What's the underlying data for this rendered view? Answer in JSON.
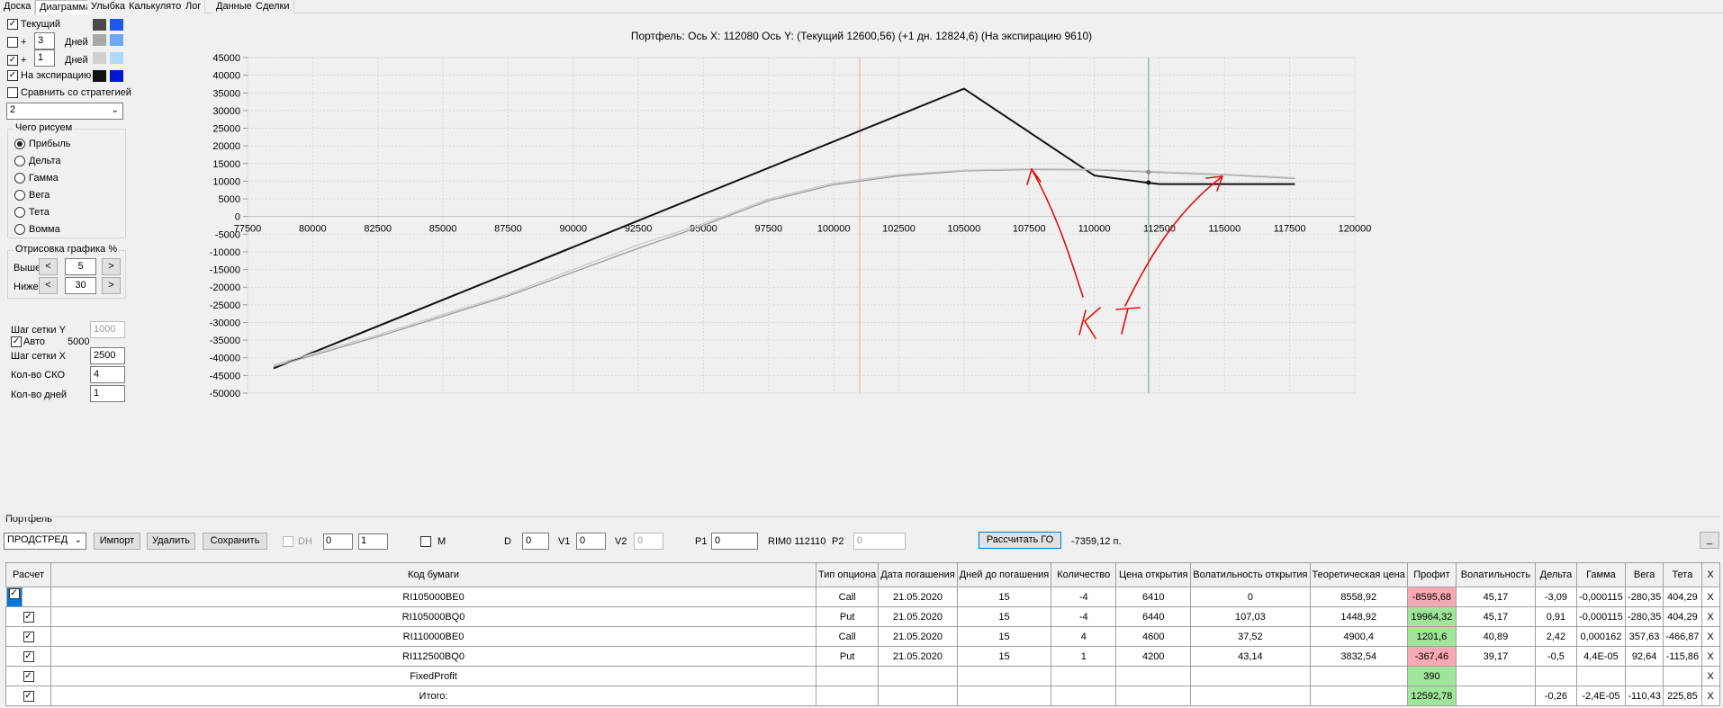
{
  "tabs": [
    "Доска",
    "Диаграмма",
    "Улыбка",
    "Калькулятор",
    "Лог",
    "Данные",
    "Сделки"
  ],
  "active_tab": "Диаграмма",
  "left_panel": {
    "current_label": "Текущий",
    "plus_label": "+",
    "days_label": "Дней",
    "days1_value": "3",
    "days2_value": "1",
    "expiry_label": "На экспирацию",
    "compare_label": "Сравнить со стратегией",
    "strategy_select": "2",
    "draw_group_title": "Чего рисуем",
    "draw_options": [
      "Прибыль",
      "Дельта",
      "Гамма",
      "Вега",
      "Тета",
      "Вомма"
    ],
    "render_group_title": "Отрисовка графика %",
    "above_label": "Выше",
    "above_value": "5",
    "below_label": "Ниже",
    "below_value": "30",
    "left_btn": "<",
    "right_btn": ">",
    "grid_y_label": "Шаг сетки Y",
    "grid_y_value": "1000",
    "auto_label": "Авто",
    "auto_value": "5000",
    "grid_x_label": "Шаг сетки X",
    "grid_x_value": "2500",
    "sko_label": "Кол-во СКО",
    "sko_value": "4",
    "days_count_label": "Кол-во дней",
    "days_count_value": "1",
    "swatches": {
      "current": [
        "#4a4a4a",
        "#1e56f0"
      ],
      "plus3": [
        "#a8a8a8",
        "#6ea8f5"
      ],
      "plus1": [
        "#cfcfcf",
        "#b0d8fa"
      ],
      "expiry": [
        "#111111",
        "#0015d0"
      ]
    }
  },
  "chart_title": "Портфель: Ось X: 112080 Ось Y:  (Текущий 12600,56)  (+1 дн. 12824,6)  (На экспирацию 9610)",
  "chart_data": {
    "type": "line",
    "xlim": [
      77500,
      120000
    ],
    "ylim": [
      -50000,
      45000
    ],
    "x_ticks": [
      "77500",
      "80000",
      "82500",
      "85000",
      "87500",
      "90000",
      "92500",
      "95000",
      "97500",
      "100000",
      "102500",
      "105000",
      "107500",
      "110000",
      "112500",
      "115000",
      "117500",
      "120000"
    ],
    "y_ticks": [
      "45000",
      "40000",
      "35000",
      "30000",
      "25000",
      "20000",
      "15000",
      "10000",
      "5000",
      "0",
      "-5000",
      "-10000",
      "-15000",
      "-20000",
      "-25000",
      "-30000",
      "-35000",
      "-40000",
      "-45000",
      "-50000"
    ],
    "red_marker_x": 101000,
    "cursor_x": 112080,
    "series": [
      {
        "color": "#111111",
        "points": [
          [
            78500,
            -43000
          ],
          [
            105000,
            36200
          ],
          [
            110000,
            11600
          ],
          [
            112000,
            9610
          ],
          [
            112500,
            9200
          ],
          [
            117700,
            9200
          ]
        ]
      },
      {
        "color": "#9a9a9a",
        "points": [
          [
            78500,
            -42500
          ],
          [
            82500,
            -34000
          ],
          [
            87500,
            -22500
          ],
          [
            92500,
            -9000
          ],
          [
            95000,
            -2500
          ],
          [
            97500,
            4500
          ],
          [
            100000,
            9000
          ],
          [
            102500,
            11500
          ],
          [
            105000,
            12900
          ],
          [
            107500,
            13300
          ],
          [
            110000,
            13200
          ],
          [
            112080,
            12600
          ],
          [
            115000,
            11800
          ],
          [
            117700,
            10800
          ]
        ]
      },
      {
        "color": "#c8c8c8",
        "points": [
          [
            78500,
            -42000
          ],
          [
            82500,
            -33500
          ],
          [
            87500,
            -22000
          ],
          [
            92500,
            -8000
          ],
          [
            95000,
            -2000
          ],
          [
            97500,
            5000
          ],
          [
            100000,
            9500
          ],
          [
            102500,
            11900
          ],
          [
            105000,
            13100
          ],
          [
            107500,
            13500
          ],
          [
            110000,
            13400
          ],
          [
            112080,
            12824
          ],
          [
            115000,
            12000
          ],
          [
            117700,
            11000
          ]
        ]
      }
    ],
    "grid": true,
    "annotation": "КТ"
  },
  "portfolio": {
    "group_label": "Портфель",
    "portfolio_select": "ПРОДСТРЕД",
    "import_btn": "Импорт",
    "delete_btn": "Удалить",
    "save_btn": "Сохранить",
    "dh_label": "DH",
    "dh_v1": "0",
    "dh_v2": "1",
    "m_label": "M",
    "d_label": "D",
    "d_value": "0",
    "v1_label": "V1",
    "v1_value": "0",
    "v2_label": "V2",
    "v2_value": "0",
    "p1_label": "P1",
    "p1_value": "0",
    "rim_label": "RIM0 112110",
    "p2_label": "P2",
    "p2_value": "0",
    "calc_btn": "Рассчитать ГО",
    "go_value": "-7359,12 п.",
    "min_btn": "_"
  },
  "table": {
    "headers": [
      "Расчет",
      "Код бумаги",
      "Тип опциона",
      "Дата погашения",
      "Дней до погашения",
      "Количество",
      "Цена открытия",
      "Волатильность открытия",
      "Теоретическая цена",
      "Профит",
      "Волатильность",
      "Дельта",
      "Гамма",
      "Вега",
      "Тета",
      "X"
    ],
    "rows": [
      {
        "code": "RI105000BE0",
        "type": "Call",
        "date": "21.05.2020",
        "days": "15",
        "qty": "-4",
        "open": "6410",
        "vol_open": "0",
        "theo": "8558,92",
        "profit": "-8595,68",
        "profit_sign": "neg",
        "vol": "45,17",
        "delta": "-3,09",
        "gamma": "-0,000115",
        "vega": "-280,35",
        "theta": "404,29",
        "x": "X"
      },
      {
        "code": "RI105000BQ0",
        "type": "Put",
        "date": "21.05.2020",
        "days": "15",
        "qty": "-4",
        "open": "6440",
        "vol_open": "107,03",
        "theo": "1448,92",
        "profit": "19964,32",
        "profit_sign": "pos",
        "vol": "45,17",
        "delta": "0,91",
        "gamma": "-0,000115",
        "vega": "-280,35",
        "theta": "404,29",
        "x": "X"
      },
      {
        "code": "RI110000BE0",
        "type": "Call",
        "date": "21.05.2020",
        "days": "15",
        "qty": "4",
        "open": "4600",
        "vol_open": "37,52",
        "theo": "4900,4",
        "profit": "1201,6",
        "profit_sign": "pos",
        "vol": "40,89",
        "delta": "2,42",
        "gamma": "0,000162",
        "vega": "357,63",
        "theta": "-466,87",
        "x": "X"
      },
      {
        "code": "RI112500BQ0",
        "type": "Put",
        "date": "21.05.2020",
        "days": "15",
        "qty": "1",
        "open": "4200",
        "vol_open": "43,14",
        "theo": "3832,54",
        "profit": "-367,46",
        "profit_sign": "neg",
        "vol": "39,17",
        "delta": "-0,5",
        "gamma": "4,4E-05",
        "vega": "92,64",
        "theta": "-115,86",
        "x": "X"
      },
      {
        "code": "FixedProfit",
        "type": "",
        "date": "",
        "days": "",
        "qty": "",
        "open": "",
        "vol_open": "",
        "theo": "",
        "profit": "390",
        "profit_sign": "pos",
        "vol": "",
        "delta": "",
        "gamma": "",
        "vega": "",
        "theta": "",
        "x": "X"
      },
      {
        "code": "Итого:",
        "type": "",
        "date": "",
        "days": "",
        "qty": "",
        "open": "",
        "vol_open": "",
        "theo": "",
        "profit": "12592,78",
        "profit_sign": "pos",
        "vol": "",
        "delta": "-0,26",
        "gamma": "-2,4E-05",
        "vega": "-110,43",
        "theta": "225,85",
        "x": "X"
      }
    ]
  }
}
